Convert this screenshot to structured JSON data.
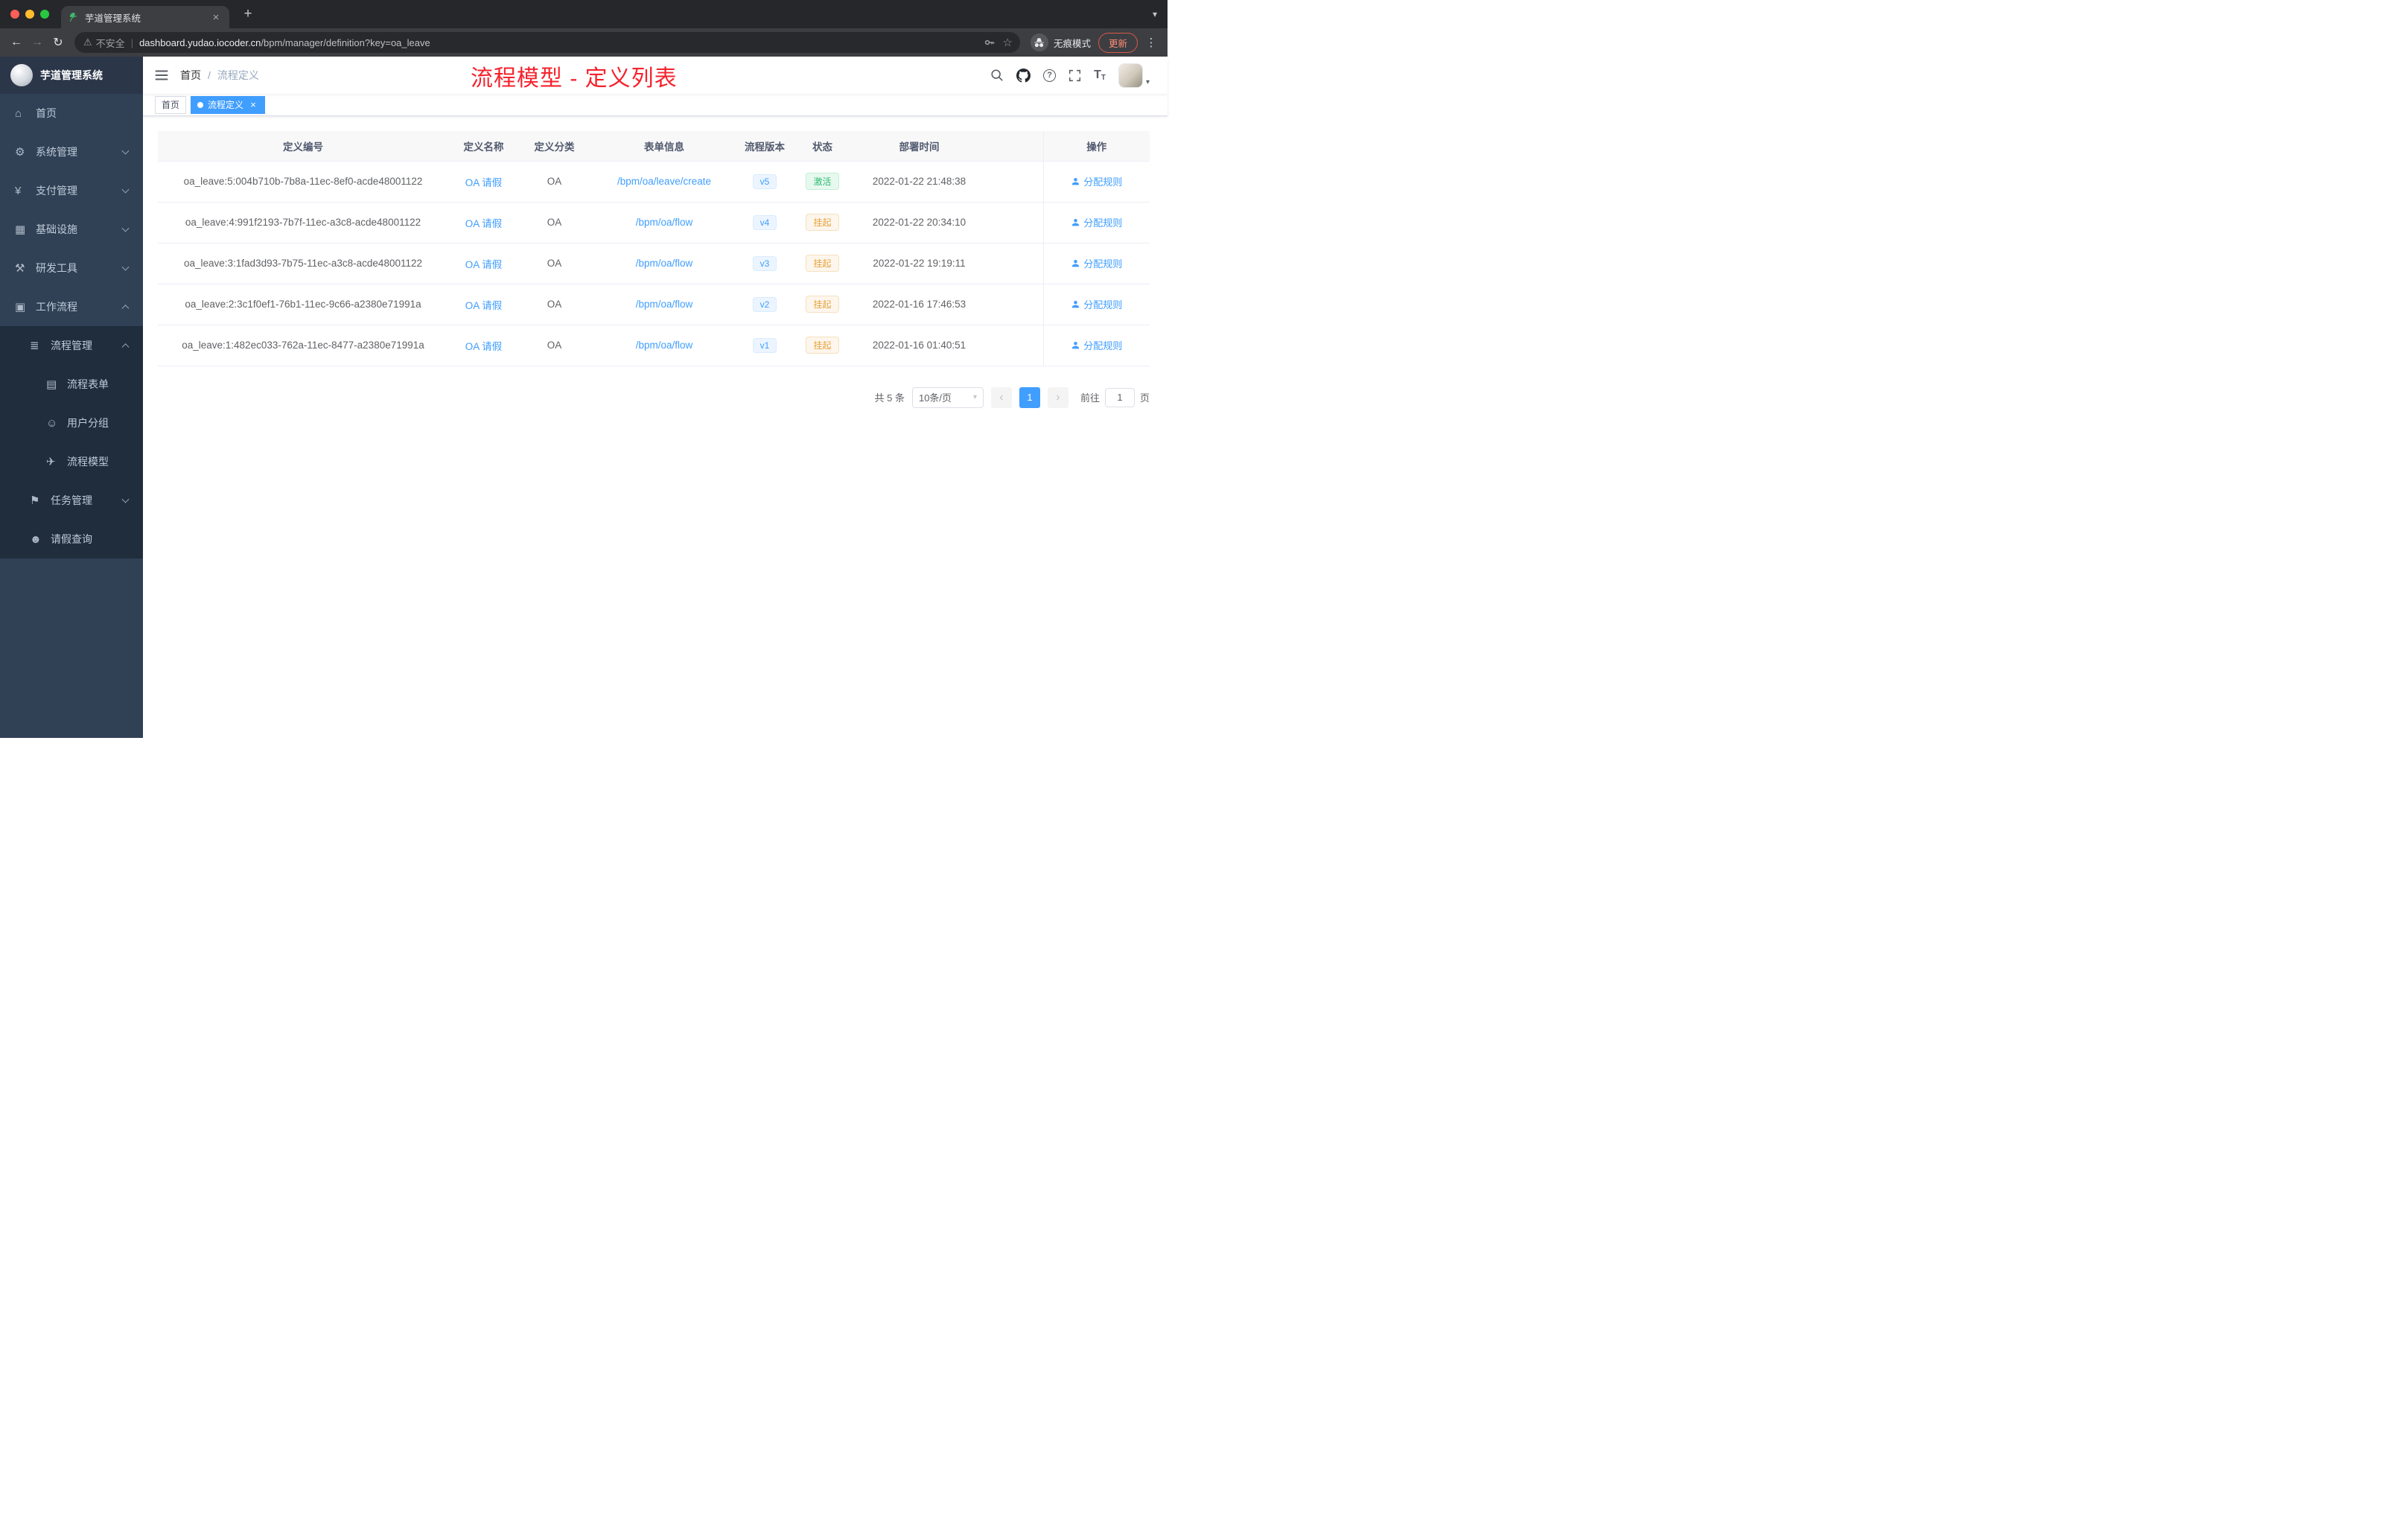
{
  "colors": {
    "accent_blue": "#409eff",
    "annotation_red": "#f5222d",
    "success_green": "#2fbb72",
    "warning_orange": "#e6a23c",
    "sidebar_bg": "#304156",
    "submenu_bg": "#1f2d3d"
  },
  "icons": {
    "close": "×",
    "plus": "+",
    "back": "←",
    "forward": "→",
    "reload": "↻",
    "kebab": "⋮",
    "star": "☆",
    "warning": "⚠",
    "separator": "|",
    "caret_down": "▾",
    "question": "?",
    "font_big": "T",
    "font_small": "T",
    "prev": "‹",
    "next": "›"
  },
  "browser": {
    "tab_title": "芋道管理系统",
    "security_label": "不安全",
    "url_host": "dashboard.yudao.iocoder.cn",
    "url_path": "/bpm/manager/definition?key=oa_leave",
    "incognito_label": "无痕模式",
    "update_label": "更新"
  },
  "sidebar": {
    "logo_title": "芋道管理系统",
    "items": [
      {
        "label": "首页",
        "glyph": "⌂",
        "name": "sidebar-item-home",
        "classes": [
          "level1"
        ]
      },
      {
        "label": "系统管理",
        "glyph": "⚙",
        "name": "sidebar-item-system-management",
        "classes": [
          "level1",
          "arrow-down"
        ]
      },
      {
        "label": "支付管理",
        "glyph": "¥",
        "name": "sidebar-item-payment-management",
        "classes": [
          "level1",
          "arrow-down"
        ]
      },
      {
        "label": "基础设施",
        "glyph": "▦",
        "name": "sidebar-item-infrastructure",
        "classes": [
          "level1",
          "arrow-down"
        ]
      },
      {
        "label": "研发工具",
        "glyph": "⚒",
        "name": "sidebar-item-dev-tools",
        "classes": [
          "level1",
          "arrow-down"
        ]
      },
      {
        "label": "工作流程",
        "glyph": "▣",
        "name": "sidebar-item-workflow",
        "classes": [
          "level1",
          "arrow-up"
        ]
      },
      {
        "label": "流程管理",
        "glyph": "≣",
        "name": "sidebar-item-process-management",
        "classes": [
          "level2",
          "arrow-up"
        ]
      },
      {
        "label": "流程表单",
        "glyph": "▤",
        "name": "sidebar-item-process-form",
        "classes": [
          "level3"
        ]
      },
      {
        "label": "用户分组",
        "glyph": "☺",
        "name": "sidebar-item-user-group",
        "classes": [
          "level3"
        ]
      },
      {
        "label": "流程模型",
        "glyph": "✈",
        "name": "sidebar-item-process-model",
        "classes": [
          "level3"
        ]
      },
      {
        "label": "任务管理",
        "glyph": "⚑",
        "name": "sidebar-item-task-management",
        "classes": [
          "level2",
          "arrow-down"
        ]
      },
      {
        "label": "请假查询",
        "glyph": "☻",
        "name": "sidebar-item-leave-query",
        "classes": [
          "level2"
        ]
      }
    ]
  },
  "header": {
    "breadcrumb_home": "首页",
    "breadcrumb_separator": "/",
    "breadcrumb_current": "流程定义",
    "annotation": "流程模型 - 定义列表"
  },
  "tags": [
    {
      "label": "首页",
      "name": "tag-home",
      "classes": []
    },
    {
      "label": "流程定义",
      "name": "tag-process-definition",
      "classes": [
        "active"
      ]
    }
  ],
  "table": {
    "columns": {
      "id": "定义编号",
      "name": "定义名称",
      "category": "定义分类",
      "form": "表单信息",
      "version": "流程版本",
      "status": "状态",
      "deploy_time": "部署时间",
      "actions": "操作"
    },
    "rows": [
      {
        "id": "oa_leave:5:004b710b-7b8a-11ec-8ef0-acde48001122",
        "name": "OA 请假",
        "category": "OA",
        "form": "/bpm/oa/leave/create",
        "version": "v5",
        "status": "激活",
        "classes": [
          "status-success"
        ],
        "deploy_time": "2022-01-22 21:48:38",
        "action": "分配规则"
      },
      {
        "id": "oa_leave:4:991f2193-7b7f-11ec-a3c8-acde48001122",
        "name": "OA 请假",
        "category": "OA",
        "form": "/bpm/oa/flow",
        "version": "v4",
        "status": "挂起",
        "classes": [
          "status-warning"
        ],
        "deploy_time": "2022-01-22 20:34:10",
        "action": "分配规则"
      },
      {
        "id": "oa_leave:3:1fad3d93-7b75-11ec-a3c8-acde48001122",
        "name": "OA 请假",
        "category": "OA",
        "form": "/bpm/oa/flow",
        "version": "v3",
        "status": "挂起",
        "classes": [
          "status-warning"
        ],
        "deploy_time": "2022-01-22 19:19:11",
        "action": "分配规则"
      },
      {
        "id": "oa_leave:2:3c1f0ef1-76b1-11ec-9c66-a2380e71991a",
        "name": "OA 请假",
        "category": "OA",
        "form": "/bpm/oa/flow",
        "version": "v2",
        "status": "挂起",
        "classes": [
          "status-warning"
        ],
        "deploy_time": "2022-01-16 17:46:53",
        "action": "分配规则"
      },
      {
        "id": "oa_leave:1:482ec033-762a-11ec-8477-a2380e71991a",
        "name": "OA 请假",
        "category": "OA",
        "form": "/bpm/oa/flow",
        "version": "v1",
        "status": "挂起",
        "classes": [
          "status-warning"
        ],
        "deploy_time": "2022-01-16 01:40:51",
        "action": "分配规则"
      }
    ]
  },
  "pagination": {
    "total": "共 5 条",
    "page_size": "10条/页",
    "current_page": "1",
    "goto_label": "前往",
    "goto_value": "1",
    "unit_label": "页"
  }
}
